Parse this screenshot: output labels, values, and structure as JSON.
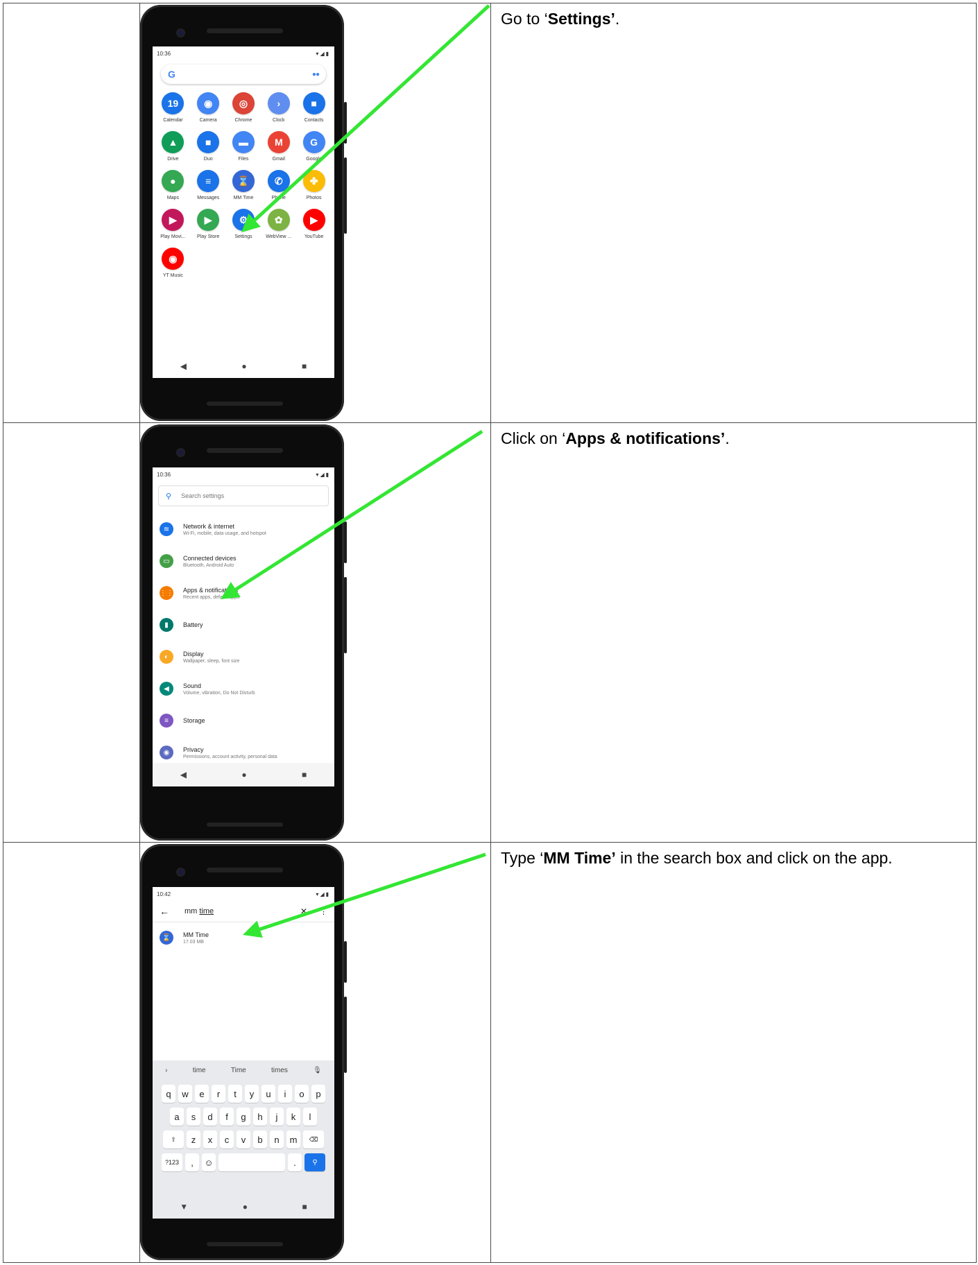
{
  "rows": [
    {
      "instruction": {
        "prefix": "Go to ‘",
        "bold": "Settings’",
        "suffix": "."
      },
      "phone": {
        "status_time": "10:36",
        "apps": [
          {
            "label": "Calendar",
            "glyph": "19",
            "color": "#1a73e8",
            "icon": "calendar-icon"
          },
          {
            "label": "Camera",
            "glyph": "◉",
            "color": "#4285f4",
            "icon": "camera-icon"
          },
          {
            "label": "Chrome",
            "glyph": "◎",
            "color": "#db4437",
            "icon": "chrome-icon"
          },
          {
            "label": "Clock",
            "glyph": "›",
            "color": "#5f8ef0",
            "icon": "clock-icon"
          },
          {
            "label": "Contacts",
            "glyph": "■",
            "color": "#1a73e8",
            "icon": "contacts-icon"
          },
          {
            "label": "Drive",
            "glyph": "▲",
            "color": "#0f9d58",
            "icon": "drive-icon"
          },
          {
            "label": "Duo",
            "glyph": "■",
            "color": "#1a73e8",
            "icon": "duo-icon"
          },
          {
            "label": "Files",
            "glyph": "▬",
            "color": "#4285f4",
            "icon": "files-icon"
          },
          {
            "label": "Gmail",
            "glyph": "M",
            "color": "#ea4335",
            "icon": "gmail-icon"
          },
          {
            "label": "Google",
            "glyph": "G",
            "color": "#4285f4",
            "icon": "google-icon"
          },
          {
            "label": "Maps",
            "glyph": "●",
            "color": "#34a853",
            "icon": "maps-icon"
          },
          {
            "label": "Messages",
            "glyph": "≡",
            "color": "#1a73e8",
            "icon": "messages-icon"
          },
          {
            "label": "MM Time",
            "glyph": "⌛",
            "color": "#3367d6",
            "icon": "hourglass-icon"
          },
          {
            "label": "Phone",
            "glyph": "✆",
            "color": "#1a73e8",
            "icon": "phone-icon"
          },
          {
            "label": "Photos",
            "glyph": "✤",
            "color": "#fbbc05",
            "icon": "photos-icon"
          },
          {
            "label": "Play Movi...",
            "glyph": "▶",
            "color": "#c2185b",
            "icon": "play-movies-icon"
          },
          {
            "label": "Play Store",
            "glyph": "▶",
            "color": "#34a853",
            "icon": "play-store-icon"
          },
          {
            "label": "Settings",
            "glyph": "⚙",
            "color": "#1a73e8",
            "icon": "settings-icon"
          },
          {
            "label": "WebView ...",
            "glyph": "✿",
            "color": "#7cb342",
            "icon": "webview-icon"
          },
          {
            "label": "YouTube",
            "glyph": "▶",
            "color": "#ff0000",
            "icon": "youtube-icon"
          },
          {
            "label": "YT Music",
            "glyph": "◉",
            "color": "#ff0000",
            "icon": "yt-music-icon"
          }
        ]
      }
    },
    {
      "instruction": {
        "prefix": "Click on ‘",
        "bold": "Apps & notifications’",
        "suffix": "."
      },
      "phone": {
        "status_time": "10:36",
        "search_placeholder": "Search settings",
        "items": [
          {
            "title": "Network & internet",
            "sub": "Wi-Fi, mobile, data usage, and hotspot",
            "color": "#1a73e8",
            "icon": "wifi-icon",
            "glyph": "≋"
          },
          {
            "title": "Connected devices",
            "sub": "Bluetooth, Android Auto",
            "color": "#43a047",
            "icon": "devices-icon",
            "glyph": "▭"
          },
          {
            "title": "Apps & notifications",
            "sub": "Recent apps, default apps",
            "color": "#f57c00",
            "icon": "apps-icon",
            "glyph": "⋮⋮"
          },
          {
            "title": "Battery",
            "sub": "",
            "color": "#00796b",
            "icon": "battery-icon",
            "glyph": "▮"
          },
          {
            "title": "Display",
            "sub": "Wallpaper, sleep, font size",
            "color": "#f9a825",
            "icon": "display-icon",
            "glyph": "◐"
          },
          {
            "title": "Sound",
            "sub": "Volume, vibration, Do Not Disturb",
            "color": "#00897b",
            "icon": "sound-icon",
            "glyph": "◀"
          },
          {
            "title": "Storage",
            "sub": "",
            "color": "#7e57c2",
            "icon": "storage-icon",
            "glyph": "≡"
          },
          {
            "title": "Privacy",
            "sub": "Permissions, account activity, personal data",
            "color": "#5c6bc0",
            "icon": "privacy-icon",
            "glyph": "◉"
          }
        ]
      }
    },
    {
      "instruction": {
        "prefix": "Type ‘",
        "bold": "MM Time’",
        "suffix": " in the search box and click on the app."
      },
      "phone": {
        "status_time": "10:42",
        "query_prefix": "mm ",
        "query_underlined": "time",
        "result_title": "MM Time",
        "result_size": "17.03 MB",
        "suggestions": [
          "time",
          "Time",
          "times"
        ],
        "keys_row1": [
          "q",
          "w",
          "e",
          "r",
          "t",
          "y",
          "u",
          "i",
          "o",
          "p"
        ],
        "keys_row2": [
          "a",
          "s",
          "d",
          "f",
          "g",
          "h",
          "j",
          "k",
          "l"
        ],
        "keys_row3": [
          "z",
          "x",
          "c",
          "v",
          "b",
          "n",
          "m"
        ],
        "key_shift": "⇧",
        "key_backspace": "⌫",
        "key_symbols": "?123",
        "key_comma": ",",
        "key_emoji": "☺",
        "key_period": ".",
        "key_search": "🔍"
      }
    }
  ],
  "nav": {
    "back": "◀",
    "home": "●",
    "recents": "■"
  },
  "colors": {
    "arrow": "#33e633"
  }
}
